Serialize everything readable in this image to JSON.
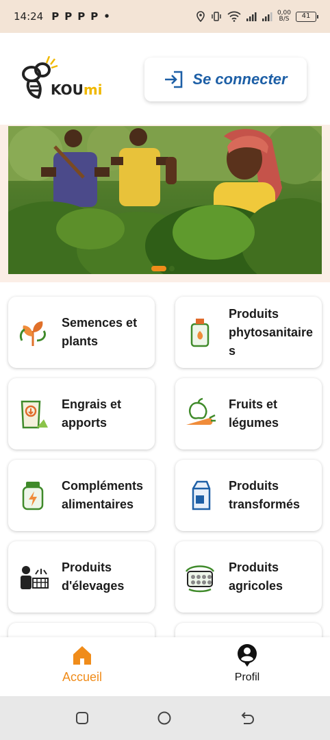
{
  "status_bar": {
    "time": "14:24",
    "app_letters": [
      "P",
      "P",
      "P",
      "P",
      "•"
    ],
    "speed": "0,00\nB/S",
    "battery": "41"
  },
  "header": {
    "logo_text_a": "KOU",
    "logo_text_b": "mi",
    "login_label": "Se connecter"
  },
  "categories": [
    {
      "label": "Semences et plants",
      "icon": "seedling-icon"
    },
    {
      "label": "Produits phytosanitaires",
      "icon": "spray-bottle-icon"
    },
    {
      "label": "Engrais et apports",
      "icon": "fertilizer-bag-icon"
    },
    {
      "label": "Fruits et légumes",
      "icon": "fruit-vegetable-icon"
    },
    {
      "label": "Compléments alimentaires",
      "icon": "supplement-jar-icon"
    },
    {
      "label": "Produits transformés",
      "icon": "milk-carton-icon"
    },
    {
      "label": "Produits d'élevages",
      "icon": "livestock-farmer-icon"
    },
    {
      "label": "Produits agricoles",
      "icon": "egg-tray-icon"
    }
  ],
  "bottom_nav": {
    "home_label": "Accueil",
    "profile_label": "Profil"
  },
  "colors": {
    "accent": "#f08c1a",
    "link_blue": "#1d5fa6",
    "status_bg": "#f3e4d6"
  }
}
